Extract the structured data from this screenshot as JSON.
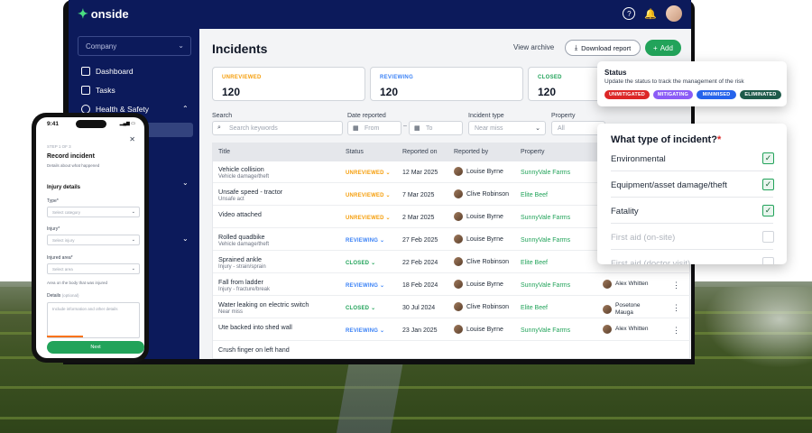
{
  "app": {
    "logo": "onside"
  },
  "sidebar": {
    "company": "Company",
    "items": [
      {
        "label": "Dashboard"
      },
      {
        "label": "Tasks"
      },
      {
        "label": "Health & Safety"
      }
    ]
  },
  "header": {
    "title": "Incidents",
    "view_archive": "View archive",
    "download": "Download report",
    "add": "Add"
  },
  "summary": [
    {
      "label": "UNREVIEWED",
      "value": "120",
      "color": "#f59e0b"
    },
    {
      "label": "REVIEWING",
      "value": "120",
      "color": "#3b82f6"
    },
    {
      "label": "CLOSED",
      "value": "120",
      "color": "#22a35a"
    }
  ],
  "filters": {
    "search_label": "Search",
    "search_placeholder": "Search keywords",
    "date_label": "Date reported",
    "from": "From",
    "to": "To",
    "type_label": "Incident type",
    "type_value": "Near miss",
    "property_label": "Property",
    "property_value": "All"
  },
  "table": {
    "headers": [
      "Title",
      "Status",
      "Reported on",
      "Reported by",
      "Property"
    ],
    "rows": [
      {
        "title": "Vehicle collision",
        "sub": "Vehicle damage/theft",
        "status": "UNREVIEWED",
        "date": "12 Mar 2025",
        "by": "Louise Byrne",
        "property": "SunnyVale Farms",
        "assignee": ""
      },
      {
        "title": "Unsafe speed - tractor",
        "sub": "Unsafe act",
        "status": "UNREVIEWED",
        "date": "7 Mar 2025",
        "by": "Clive Robinson",
        "property": "Elite Beef",
        "assignee": ""
      },
      {
        "title": "Video attached",
        "sub": "",
        "status": "UNREVIEWED",
        "date": "2 Mar 2025",
        "by": "Louise Byrne",
        "property": "SunnyVale Farms",
        "assignee": ""
      },
      {
        "title": "Rolled quadbike",
        "sub": "Vehicle damage/theft",
        "status": "REVIEWING",
        "date": "27 Feb 2025",
        "by": "Louise Byrne",
        "property": "SunnyVale Farms",
        "assignee": ""
      },
      {
        "title": "Sprained ankle",
        "sub": "Injury - strain/sprain",
        "status": "CLOSED",
        "date": "22 Feb 2024",
        "by": "Clive Robinson",
        "property": "Elite Beef",
        "assignee": ""
      },
      {
        "title": "Fall from ladder",
        "sub": "Injury - fracture/break",
        "status": "REVIEWING",
        "date": "18 Feb 2024",
        "by": "Louise Byrne",
        "property": "SunnyVale Farms",
        "assignee": "Alex Whitten"
      },
      {
        "title": "Water leaking on electric switch",
        "sub": "Near miss",
        "status": "CLOSED",
        "date": "30 Jul 2024",
        "by": "Clive Robinson",
        "property": "Elite Beef",
        "assignee": "Posetone Mauga"
      },
      {
        "title": "Ute backed into shed wall",
        "sub": "",
        "status": "REVIEWING",
        "date": "23 Jan 2025",
        "by": "Louise Byrne",
        "property": "SunnyVale Farms",
        "assignee": "Alex Whitten"
      },
      {
        "title": "Crush finger on left hand",
        "sub": "",
        "status": "",
        "date": "",
        "by": "",
        "property": "",
        "assignee": ""
      }
    ]
  },
  "status_popup": {
    "title": "Status",
    "desc": "Update the status to track the management of the risk",
    "chips": [
      {
        "label": "UNMITIGATED",
        "color": "#dc2626"
      },
      {
        "label": "MITIGATING",
        "color": "#8b5cf6"
      },
      {
        "label": "MINIMISED",
        "color": "#2563eb"
      },
      {
        "label": "ELIMINATED",
        "color": "#1e5a4a"
      }
    ]
  },
  "type_popup": {
    "question": "What type of incident?",
    "required": "*",
    "options": [
      {
        "label": "Environmental",
        "checked": true
      },
      {
        "label": "Equipment/asset damage/theft",
        "checked": true
      },
      {
        "label": "Fatality",
        "checked": true
      },
      {
        "label": "First aid (on-site)",
        "checked": false
      },
      {
        "label": "First aid (doctor visit)",
        "checked": false
      }
    ]
  },
  "phone": {
    "time": "9:41",
    "step": "STEP 1 OF 3",
    "title": "Record incident",
    "desc": "Details about what happened",
    "section": "Injury details",
    "type_label": "Type*",
    "type_ph": "Select category",
    "injury_label": "Injury*",
    "injury_ph": "Select injury",
    "area_label": "Injured area*",
    "area_ph": "Select area",
    "hint": "Area on the body that was injured",
    "details_label": "Details",
    "details_optional": "(optional)",
    "details_ph": "Include information and other details",
    "next": "Next"
  }
}
